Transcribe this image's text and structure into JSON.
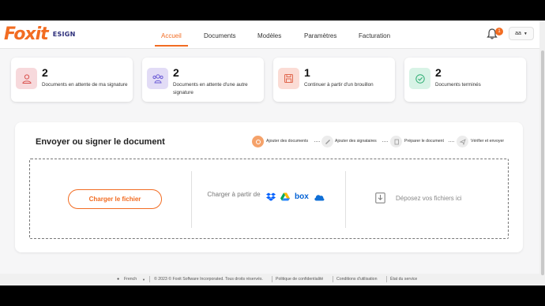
{
  "brand": {
    "logo": "Foxit",
    "product": "ESIGN"
  },
  "nav": {
    "items": [
      "Accueil",
      "Documents",
      "Modèles",
      "Paramètres",
      "Facturation"
    ],
    "active": "Accueil"
  },
  "notifications": {
    "count": "1"
  },
  "user": {
    "initials": "aa"
  },
  "stats": [
    {
      "value": "2",
      "label": "Documents en attente de ma signature",
      "icon": "user-icon",
      "color": "#f7d9dc"
    },
    {
      "value": "2",
      "label": "Documents en attente d'une autre signature",
      "icon": "users-icon",
      "color": "#e2dcf6"
    },
    {
      "value": "1",
      "label": "Continuer à partir d'un brouillon",
      "icon": "save-icon",
      "color": "#fbdcd5"
    },
    {
      "value": "2",
      "label": "Documents terminés",
      "icon": "check-circle-icon",
      "color": "#d8f3e6"
    }
  ],
  "panel": {
    "title": "Envoyer ou signer le document",
    "steps": [
      "Ajouter des documents",
      "Ajouter des signataires",
      "Préparer le document",
      "Vérifier et envoyer"
    ],
    "upload_label": "Charger le fichier",
    "cloud_label": "Charger à partir de",
    "cloud_services": [
      "dropbox-icon",
      "google-drive-icon",
      "box-icon",
      "onedrive-icon"
    ],
    "box_text": "box",
    "drop_label": "Déposez vos fichiers ici"
  },
  "footer": {
    "language": "French",
    "copyright": "© 2023 © Foxit Software Incorporated. Tous droits réservés.",
    "links": [
      "Politique de confidentialité",
      "Conditions d'utilisation",
      "État du service"
    ]
  },
  "colors": {
    "accent": "#f26c22",
    "brand_navy": "#2b2d7a"
  }
}
